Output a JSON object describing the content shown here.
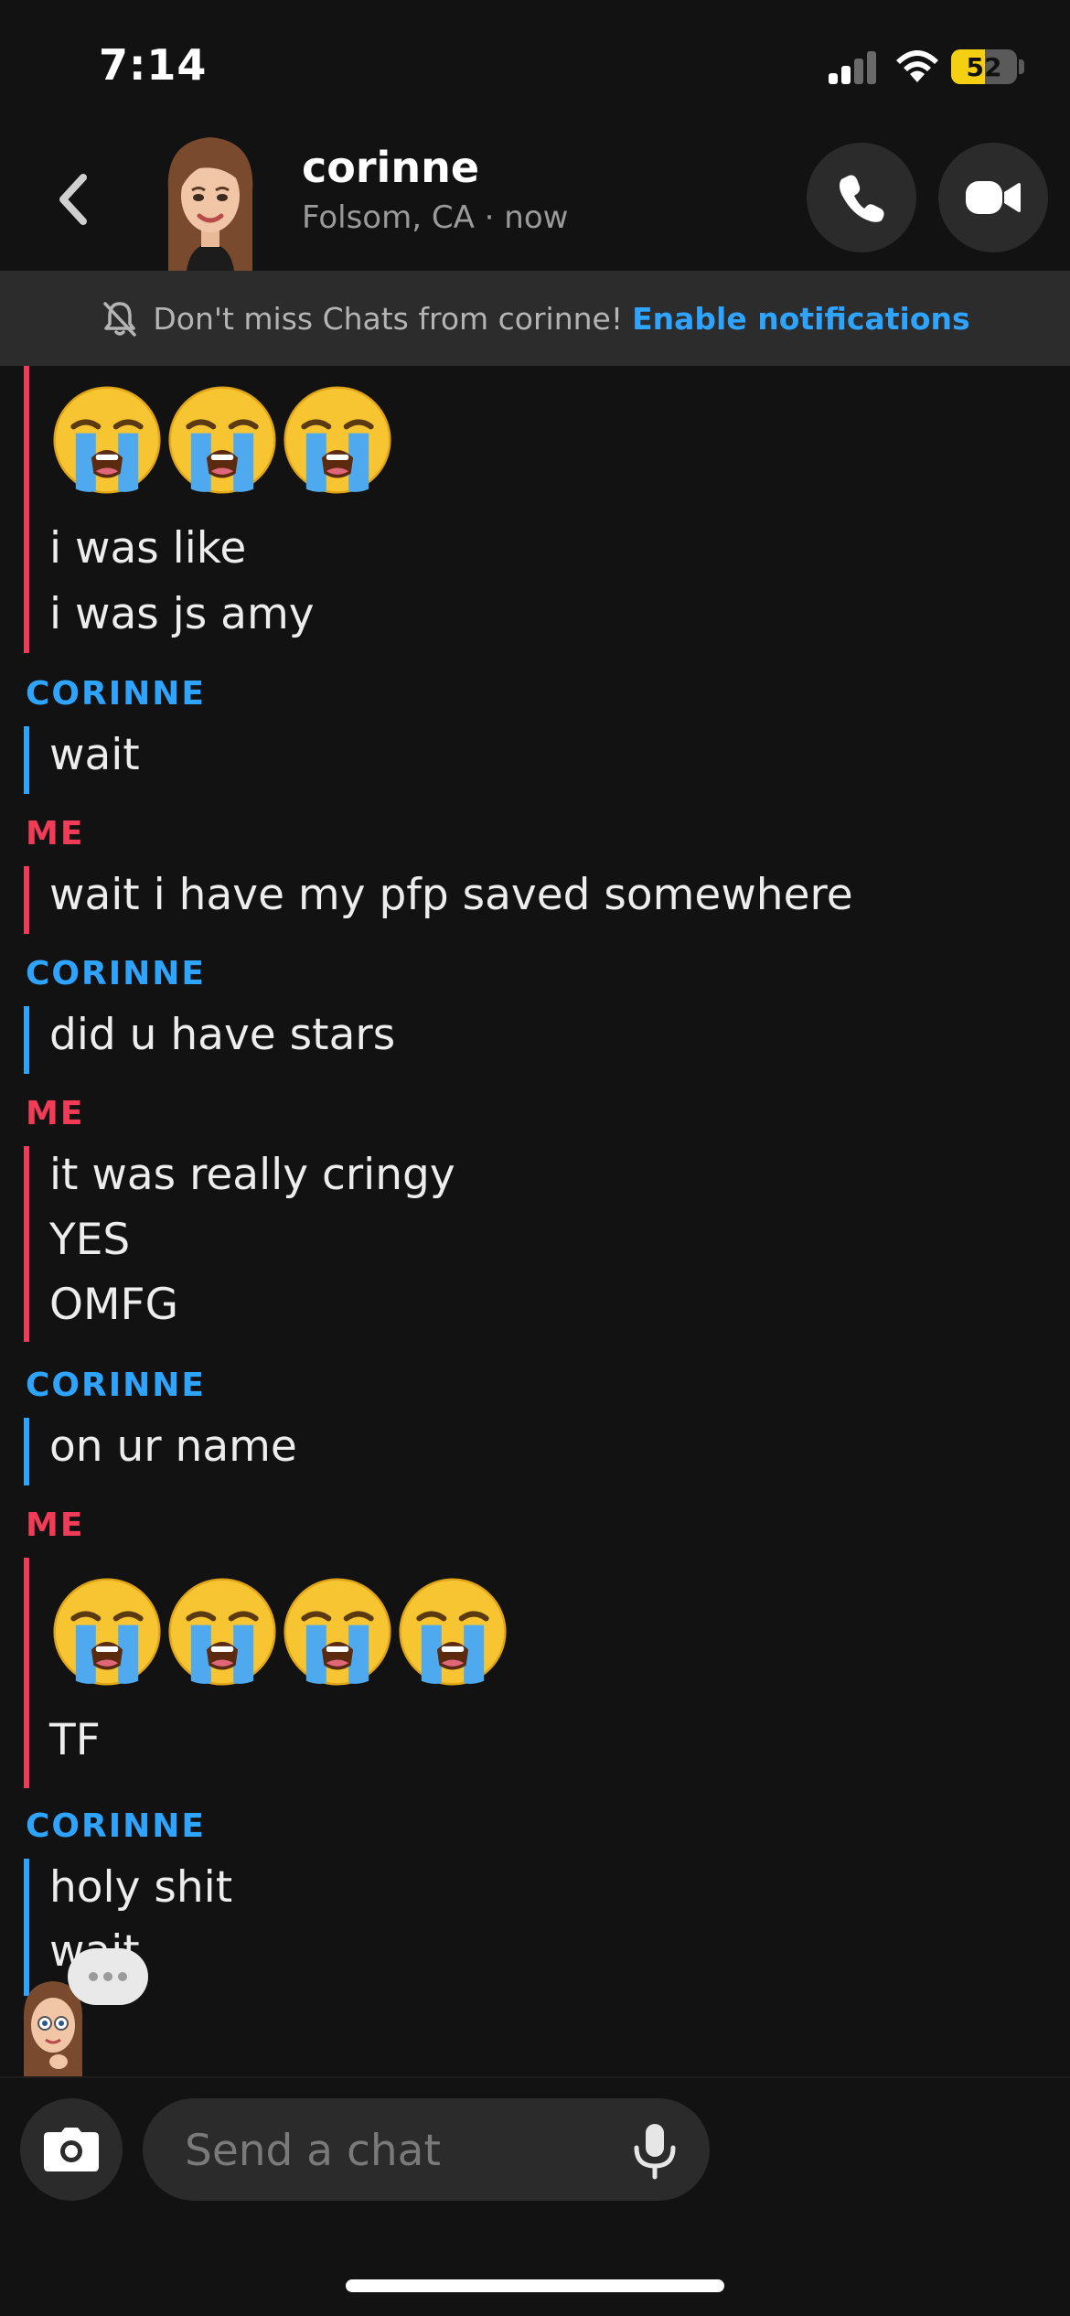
{
  "status": {
    "time": "7:14",
    "battery": "52",
    "battery_level": 0.52
  },
  "header": {
    "contact_name": "corinne",
    "location_status": "Folsom, CA · now"
  },
  "banner": {
    "message": "Don't miss Chats from corinne!",
    "link": "Enable notifications"
  },
  "messages": [
    {
      "sender": "",
      "lines": [
        "i was like",
        "i was js amy"
      ],
      "emoji_count": 3
    },
    {
      "sender": "CORINNE",
      "lines": [
        "wait"
      ]
    },
    {
      "sender": "ME",
      "lines": [
        "wait i have my pfp saved somewhere"
      ]
    },
    {
      "sender": "CORINNE",
      "lines": [
        "did u have stars"
      ]
    },
    {
      "sender": "ME",
      "lines": [
        "it was really cringy",
        "YES",
        "OMFG"
      ]
    },
    {
      "sender": "CORINNE",
      "lines": [
        "on ur name"
      ]
    },
    {
      "sender": "ME",
      "lines": [
        "TF"
      ],
      "emoji_count": 4
    },
    {
      "sender": "CORINNE",
      "lines": [
        "holy shit",
        "wait"
      ]
    }
  ],
  "composer": {
    "placeholder": "Send a chat"
  },
  "icons": {
    "back": "chevron-left-icon",
    "call": "phone-icon",
    "video": "video-camera-icon",
    "banner": "bell-off-icon",
    "camera": "camera-icon",
    "mic": "microphone-icon",
    "emoji": "loudly-crying-face-emoji"
  },
  "colors": {
    "me": "#f23c57",
    "corinne": "#2ea4ff",
    "link": "#2ea4ff",
    "background": "#121212"
  }
}
